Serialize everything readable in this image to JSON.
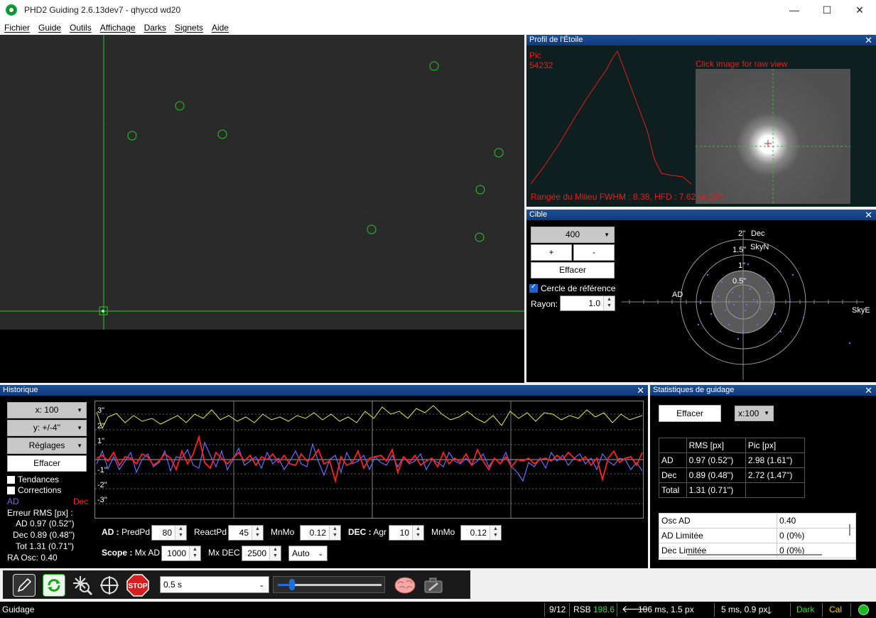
{
  "window": {
    "title": "PHD2 Guiding 2.6.13dev7 - qhyccd wd20",
    "minimize": "—",
    "maximize": "☐",
    "close": "✕"
  },
  "menu": [
    "Fichier",
    "Guide",
    "Outils",
    "Affichage",
    "Darks",
    "Signets",
    "Aide"
  ],
  "profile": {
    "title": "Profil de l'Étoile",
    "close": "✕",
    "peak_label": "Pic",
    "peak_value": "54232",
    "raw_hint": "Click image for raw view",
    "fwhm_text": "Rangée du Milieu FWHM : 8.38, HFD : 7.62 (4.13\")"
  },
  "target": {
    "title": "Cible",
    "close": "✕",
    "scale_value": "400",
    "plus": "+",
    "minus": "-",
    "clear": "Effacer",
    "ref_circle": "Cercle de référence",
    "radius_label": "Rayon:",
    "radius_value": "1.0",
    "labels": {
      "dec": "Dec",
      "skyn": "SkyN",
      "ad": "AD",
      "skye": "SkyE",
      "r2": "2\"",
      "r15": "1.5\"",
      "r1": "1\"",
      "r05": "0.5\""
    }
  },
  "history": {
    "title": "Historique",
    "close": "✕",
    "x_scale": "x: 100",
    "y_scale": "y: +/-4''",
    "settings": "Réglages",
    "clear": "Effacer",
    "trends": "Tendances",
    "corrections": "Corrections",
    "ad_label": "AD",
    "dec_label": "Dec",
    "rms_title": "Erreur RMS [px] :",
    "rms_ad": "AD  0.97 (0.52'')",
    "rms_dec": "Dec  0.89 (0.48'')",
    "rms_tot": "Tot  1.31 (0.71'')",
    "ra_osc": "RA Osc: 0.40",
    "y_labels": [
      "3\"",
      "2\"",
      "1\"",
      "-1\"",
      "-2\"",
      "-3\""
    ],
    "ad_ctrl": {
      "label": "AD :",
      "predpd": "PredPd",
      "predpd_val": "80",
      "reactpd": "ReactPd",
      "reactpd_val": "45",
      "mnmo": "MnMo",
      "mnmo_val": "0.12"
    },
    "dec_ctrl": {
      "label": "DEC :",
      "agr": "Agr",
      "agr_val": "10",
      "mnmo": "MnMo",
      "mnmo_val": "0.12"
    },
    "scope_ctrl": {
      "label": "Scope :",
      "mxad": "Mx AD",
      "mxad_val": "1000",
      "mxdec": "Mx DEC",
      "mxdec_val": "2500",
      "mode": "Auto"
    }
  },
  "stats": {
    "title": "Statistiques de guidage",
    "close": "✕",
    "clear": "Effacer",
    "scale": "x:100",
    "headers": [
      "",
      "RMS [px]",
      "Pic [px]"
    ],
    "rows": [
      [
        "AD",
        "0.97 (0.52'')",
        "2.98 (1.61'')"
      ],
      [
        "Dec",
        "0.89 (0.48'')",
        "2.72 (1.47'')"
      ],
      [
        "Total",
        "1.31 (0.71'')",
        ""
      ]
    ],
    "rows2": [
      [
        "Osc AD",
        "0.40"
      ],
      [
        "AD Limitée",
        "0 (0%)"
      ],
      [
        "Dec Limitée",
        "0 (0%)"
      ]
    ]
  },
  "toolbar": {
    "exposure": "0.5 s",
    "stop": "STOP"
  },
  "status": {
    "state": "Guidage",
    "frame": "9/12",
    "snr_label": "RSB",
    "snr_value": "198.6",
    "ra_corr": "106 ms, 1.5 px",
    "dec_corr": "5 ms, 0.9 px",
    "dark": "Dark",
    "cal": "Cal"
  },
  "colors": {
    "ra": "#6b6bff",
    "dec": "#ff2020",
    "snr": "#32dc32",
    "dark": "#32dc32",
    "cal": "#ffd700",
    "accent": "#0e3a7d"
  }
}
